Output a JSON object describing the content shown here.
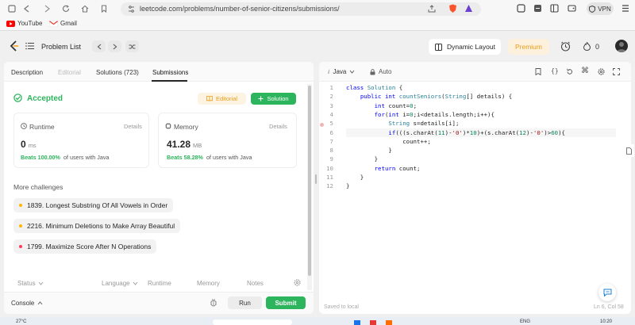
{
  "browser": {
    "url": "leetcode.com/problems/number-of-senior-citizens/submissions/",
    "vpn_label": "VPN",
    "bookmarks": [
      "YouTube",
      "Gmail"
    ]
  },
  "header": {
    "problem_list": "Problem List",
    "dynamic_layout": "Dynamic Layout",
    "premium": "Premium",
    "count": "0"
  },
  "tabs": [
    {
      "label": "Description"
    },
    {
      "label": "Editorial"
    },
    {
      "label": "Solutions (723)"
    },
    {
      "label": "Submissions"
    }
  ],
  "result": {
    "status": "Accepted",
    "editorial_btn": "Editorial",
    "solution_btn": "Solution"
  },
  "runtime": {
    "label": "Runtime",
    "details": "Details",
    "value": "0",
    "unit": "ms",
    "beats": "Beats 100.00%",
    "beats_suffix": "of users with Java"
  },
  "memory": {
    "label": "Memory",
    "details": "Details",
    "value": "41.28",
    "unit": "MB",
    "beats": "Beats 58.28%",
    "beats_suffix": "of users with Java"
  },
  "challenges": {
    "title": "More challenges",
    "items": [
      {
        "text": "1839. Longest Substring Of All Vowels in Order",
        "color": "#ffb800"
      },
      {
        "text": "2216. Minimum Deletions to Make Array Beautiful",
        "color": "#ffb800"
      },
      {
        "text": "1799. Maximize Score After N Operations",
        "color": "#ff375f"
      }
    ]
  },
  "list_header": {
    "status": "Status",
    "language": "Language",
    "runtime": "Runtime",
    "memory": "Memory",
    "notes": "Notes"
  },
  "bottom": {
    "console": "Console",
    "run": "Run",
    "submit": "Submit"
  },
  "editor": {
    "language": "Java",
    "auto": "Auto",
    "saved": "Saved to local",
    "cursor": "Ln 6, Col 58",
    "lines": [
      [
        [
          "kw",
          "class "
        ],
        [
          "ty",
          "Solution"
        ],
        [
          "tx",
          " {"
        ]
      ],
      [
        [
          "tx",
          "    "
        ],
        [
          "kw",
          "public int "
        ],
        [
          "ty",
          "countSeniors"
        ],
        [
          "tx",
          "("
        ],
        [
          "ty",
          "String"
        ],
        [
          "tx",
          "[] details) {"
        ]
      ],
      [
        [
          "tx",
          "        "
        ],
        [
          "kw",
          "int "
        ],
        [
          "tx",
          "count="
        ],
        [
          "nm",
          "0"
        ],
        [
          "tx",
          ";"
        ]
      ],
      [
        [
          "tx",
          "        "
        ],
        [
          "kw",
          "for"
        ],
        [
          "tx",
          "("
        ],
        [
          "kw",
          "int "
        ],
        [
          "tx",
          "i="
        ],
        [
          "nm",
          "0"
        ],
        [
          "tx",
          ";i<details.length;i++){"
        ]
      ],
      [
        [
          "tx",
          "            "
        ],
        [
          "ty",
          "String"
        ],
        [
          "tx",
          " s=details[i];"
        ]
      ],
      [
        [
          "tx",
          "            "
        ],
        [
          "kw",
          "if"
        ],
        [
          "tx",
          "(((s.charAt("
        ],
        [
          "nm",
          "11"
        ],
        [
          "tx",
          ")-"
        ],
        [
          "st",
          "'0'"
        ],
        [
          "tx",
          ")*"
        ],
        [
          "nm",
          "10"
        ],
        [
          "tx",
          ")+(s.charAt("
        ],
        [
          "nm",
          "12"
        ],
        [
          "tx",
          ")-"
        ],
        [
          "st",
          "'0'"
        ],
        [
          "tx",
          ")>"
        ],
        [
          "nm",
          "60"
        ],
        [
          "tx",
          "){"
        ]
      ],
      [
        [
          "tx",
          "                count++;"
        ]
      ],
      [
        [
          "tx",
          "            }"
        ]
      ],
      [
        [
          "tx",
          "        }"
        ]
      ],
      [
        [
          "tx",
          "        "
        ],
        [
          "kw",
          "return "
        ],
        [
          "tx",
          "count;"
        ]
      ],
      [
        [
          "tx",
          "    }"
        ]
      ],
      [
        [
          "tx",
          "}"
        ]
      ]
    ]
  },
  "taskbar": {
    "weather": "27°C",
    "lang": "ENG",
    "time": "10:20"
  },
  "colors": {
    "accent_green": "#2db55d",
    "premium_bg": "#fdf0dc",
    "premium_text": "#e59f1c"
  }
}
